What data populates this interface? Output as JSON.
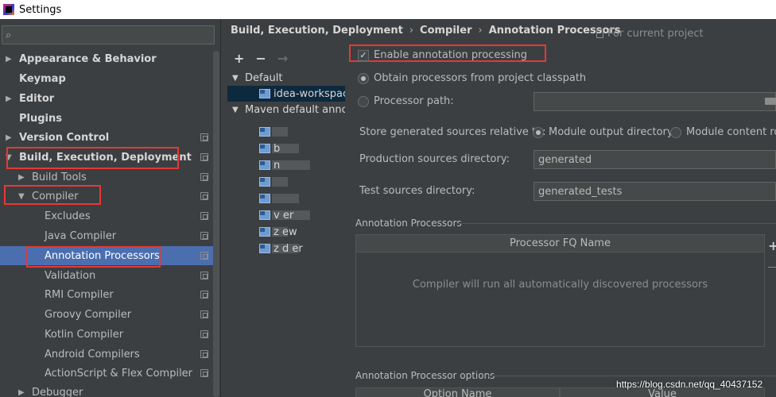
{
  "window": {
    "title": "Settings"
  },
  "search": {
    "placeholder": ""
  },
  "tree": [
    {
      "label": "Appearance & Behavior",
      "bold": true,
      "arrow": "▶"
    },
    {
      "label": "Keymap",
      "bold": true,
      "arrow": ""
    },
    {
      "label": "Editor",
      "bold": true,
      "arrow": "▶"
    },
    {
      "label": "Plugins",
      "bold": true,
      "arrow": ""
    },
    {
      "label": "Version Control",
      "bold": true,
      "arrow": "▶"
    },
    {
      "label": "Build, Execution, Deployment",
      "bold": true,
      "arrow": "▼"
    },
    {
      "label": "Build Tools",
      "bold": false,
      "arrow": "▶"
    },
    {
      "label": "Compiler",
      "bold": false,
      "arrow": "▼"
    },
    {
      "label": "Excludes",
      "bold": false,
      "arrow": ""
    },
    {
      "label": "Java Compiler",
      "bold": false,
      "arrow": ""
    },
    {
      "label": "Annotation Processors",
      "bold": false,
      "arrow": ""
    },
    {
      "label": "Validation",
      "bold": false,
      "arrow": ""
    },
    {
      "label": "RMI Compiler",
      "bold": false,
      "arrow": ""
    },
    {
      "label": "Groovy Compiler",
      "bold": false,
      "arrow": ""
    },
    {
      "label": "Kotlin Compiler",
      "bold": false,
      "arrow": ""
    },
    {
      "label": "Android Compilers",
      "bold": false,
      "arrow": ""
    },
    {
      "label": "ActionScript & Flex Compiler",
      "bold": false,
      "arrow": ""
    },
    {
      "label": "Debugger",
      "bold": false,
      "arrow": "▶"
    }
  ],
  "breadcrumb": [
    "Build, Execution, Deployment",
    "Compiler",
    "Annotation Processors"
  ],
  "breadcrumb_sep": "›",
  "for_project": "For current project",
  "profiles": {
    "add": "+",
    "remove": "−",
    "move": "→",
    "default_label": "Default",
    "default_child": "idea-workspace",
    "maven_label": "Maven default annota",
    "modules": [
      "",
      "b",
      "n",
      "",
      "",
      "v  er",
      "z  ew",
      "z  d  er"
    ]
  },
  "options": {
    "enable_label": "Enable annotation processing",
    "enable_checked": true,
    "classpath_label": "Obtain processors from project classpath",
    "path_label": "Processor path:",
    "path_value": "",
    "store_label": "Store generated sources relative to:",
    "module_output_label": "Module output directory",
    "module_content_label": "Module content roo",
    "prod_label": "Production sources directory:",
    "prod_value": "generated",
    "test_label": "Test sources directory:",
    "test_value": "generated_tests"
  },
  "processors": {
    "section_title": "Annotation Processors",
    "column": "Processor FQ Name",
    "empty_text": "Compiler will run all automatically discovered processors",
    "add": "+"
  },
  "processor_options": {
    "section_title": "Annotation Processor options",
    "col_name": "Option Name",
    "col_value": "Value"
  },
  "watermark": "https://blog.csdn.net/qq_40437152",
  "colors": {
    "highlight": "#e53935",
    "selection": "#4b6eaf",
    "background": "#3c3f41"
  }
}
